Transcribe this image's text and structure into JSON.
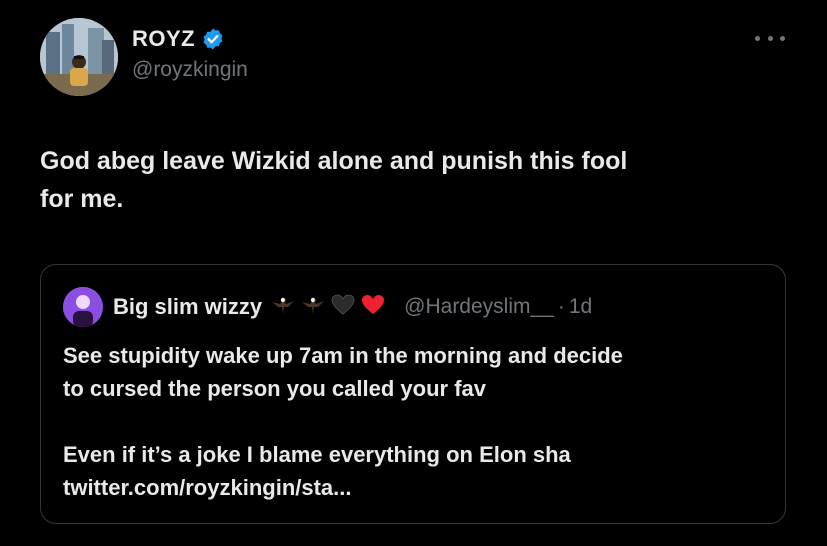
{
  "author": {
    "display_name": "ROYZ",
    "handle": "@royzkingin",
    "verified": true
  },
  "tweet": {
    "text_line1": "God abeg leave Wizkid alone and punish this fool",
    "text_line2": "for me."
  },
  "quoted_tweet": {
    "display_name": "Big slim wizzy",
    "emojis": [
      "eagle-emoji",
      "eagle-emoji",
      "black-heart-emoji",
      "red-heart-emoji"
    ],
    "handle": "@Hardeyslim__",
    "separator": "·",
    "time": "1d",
    "line1": "See stupidity wake up 7am in the morning and decide",
    "line2": "to cursed the person you called your fav",
    "line3": "Even if it’s a joke I blame everything on Elon sha",
    "line4": "twitter.com/royzkingin/sta..."
  },
  "colors": {
    "background": "#000000",
    "text": "#e7e9ea",
    "secondary": "#71767b",
    "border": "#333639",
    "verified": "#1d9bf0"
  }
}
